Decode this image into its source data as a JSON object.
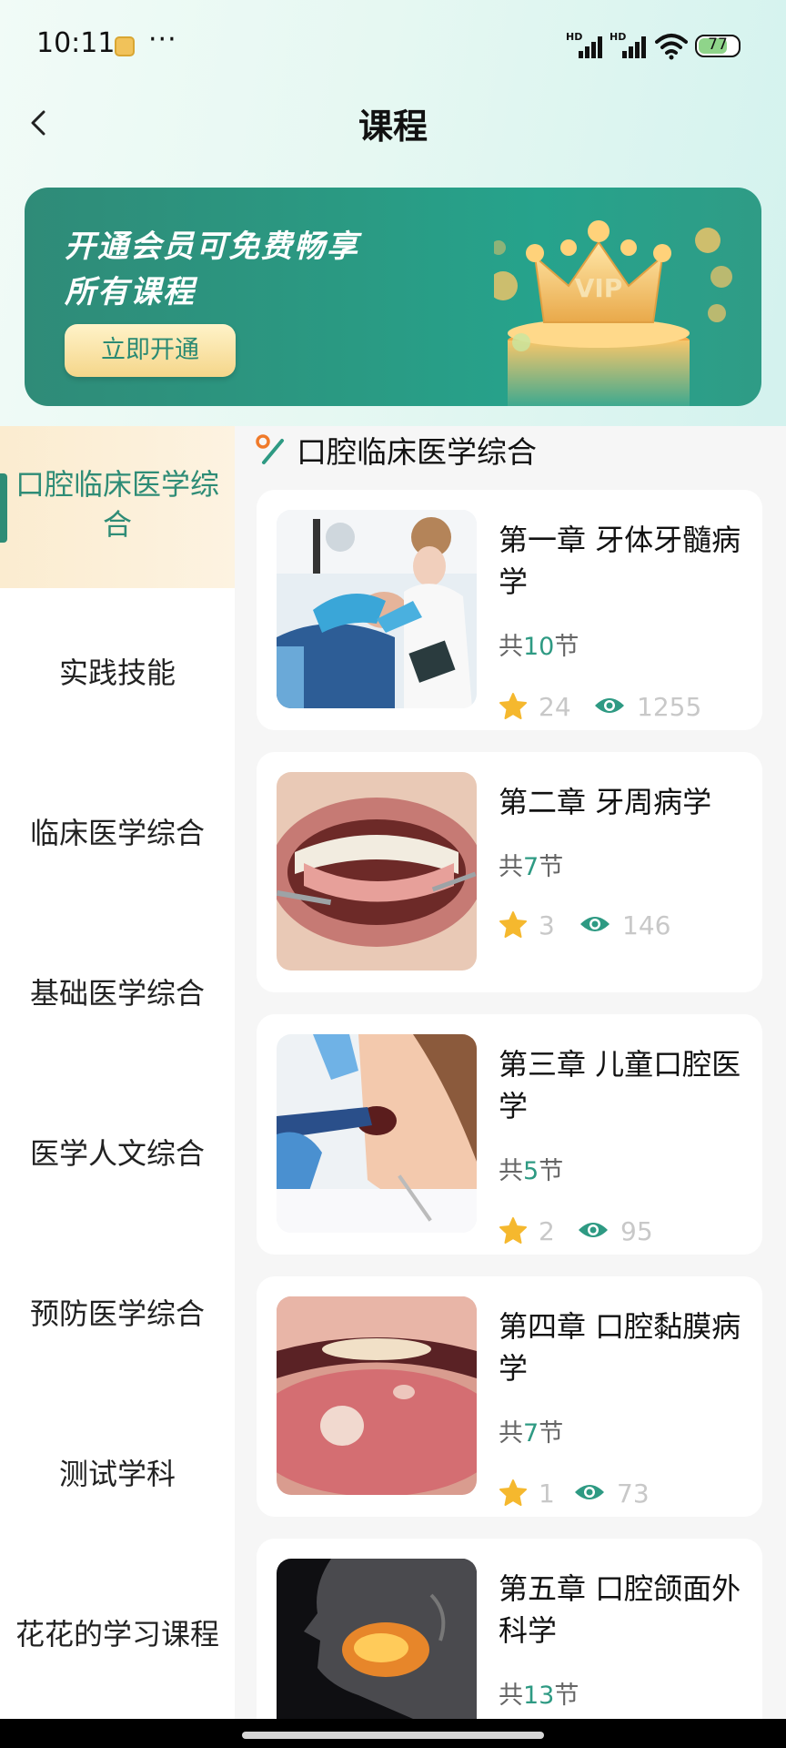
{
  "status_bar": {
    "time": "10:11",
    "more": "···",
    "battery": "77",
    "battery_level": 0.77,
    "signal_label": "HD"
  },
  "header": {
    "title": "课程"
  },
  "banner": {
    "line1": "开通会员可免费畅享",
    "line2": "所有课程",
    "button": "立即开通",
    "badge": "VIP"
  },
  "sidebar": {
    "items": [
      {
        "label": "口腔临床医学综合",
        "active": true
      },
      {
        "label": "实践技能"
      },
      {
        "label": "临床医学综合"
      },
      {
        "label": "基础医学综合"
      },
      {
        "label": "医学人文综合"
      },
      {
        "label": "预防医学综合"
      },
      {
        "label": "测试学科"
      },
      {
        "label": "花花的学习课程"
      }
    ]
  },
  "section": {
    "title": "口腔临床医学综合"
  },
  "courses": [
    {
      "title": "第一章 牙体牙髓病学",
      "lessons_prefix": "共",
      "lessons": "10",
      "lessons_suffix": "节",
      "stars": "24",
      "views": "1255"
    },
    {
      "title": "第二章 牙周病学",
      "lessons_prefix": "共",
      "lessons": "7",
      "lessons_suffix": "节",
      "stars": "3",
      "views": "146"
    },
    {
      "title": "第三章 儿童口腔医学",
      "lessons_prefix": "共",
      "lessons": "5",
      "lessons_suffix": "节",
      "stars": "2",
      "views": "95"
    },
    {
      "title": "第四章 口腔黏膜病学",
      "lessons_prefix": "共",
      "lessons": "7",
      "lessons_suffix": "节",
      "stars": "1",
      "views": "73"
    },
    {
      "title": "第五章 口腔颌面外科学",
      "lessons_prefix": "共",
      "lessons": "13",
      "lessons_suffix": "节"
    }
  ],
  "colors": {
    "accent": "#2e8c76",
    "banner": "#2a9a83",
    "star": "#f5b82e"
  }
}
